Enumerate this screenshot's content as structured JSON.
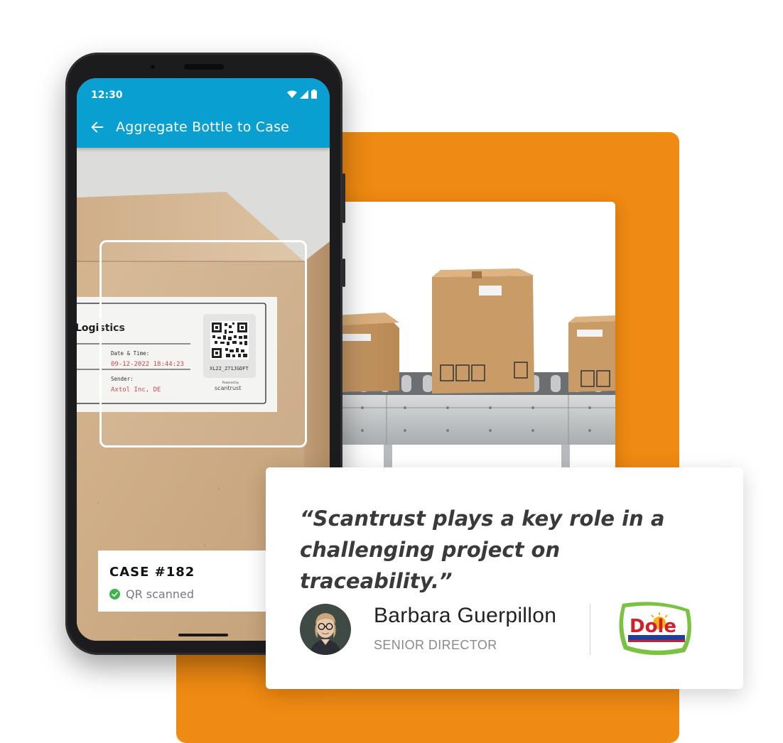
{
  "phone": {
    "status": {
      "time": "12:30",
      "icons": [
        "wifi-icon",
        "signal-icon",
        "battery-icon"
      ]
    },
    "appbar": {
      "title": "Aggregate Bottle to Case",
      "back_icon": "arrow-left-icon",
      "color": "#0a9fd1"
    },
    "label": {
      "company": "Logistics",
      "date_label": "Date & Time:",
      "date_value": "09-12-2022 18:44:23",
      "sender_label": "Sender:",
      "sender_value": "Axtol Inc, DE",
      "qr_code_text": "XL22_271JGDFT",
      "powered_by": "Powered by",
      "brand": "scantrust"
    },
    "case_card": {
      "title": "CASE #182",
      "status": "QR scanned",
      "status_icon": "check-circle-icon",
      "status_color": "#3bb54a"
    }
  },
  "quote": {
    "text_line1": "“Scantrust plays a key role in a",
    "text_line2": "challenging project on traceability.”",
    "person_name": "Barbara Guerpillon",
    "person_role": "SENIOR DIRECTOR",
    "logo_text": "Dole"
  },
  "colors": {
    "accent_orange": "#ef8a12",
    "appbar_blue": "#0a9fd1"
  }
}
